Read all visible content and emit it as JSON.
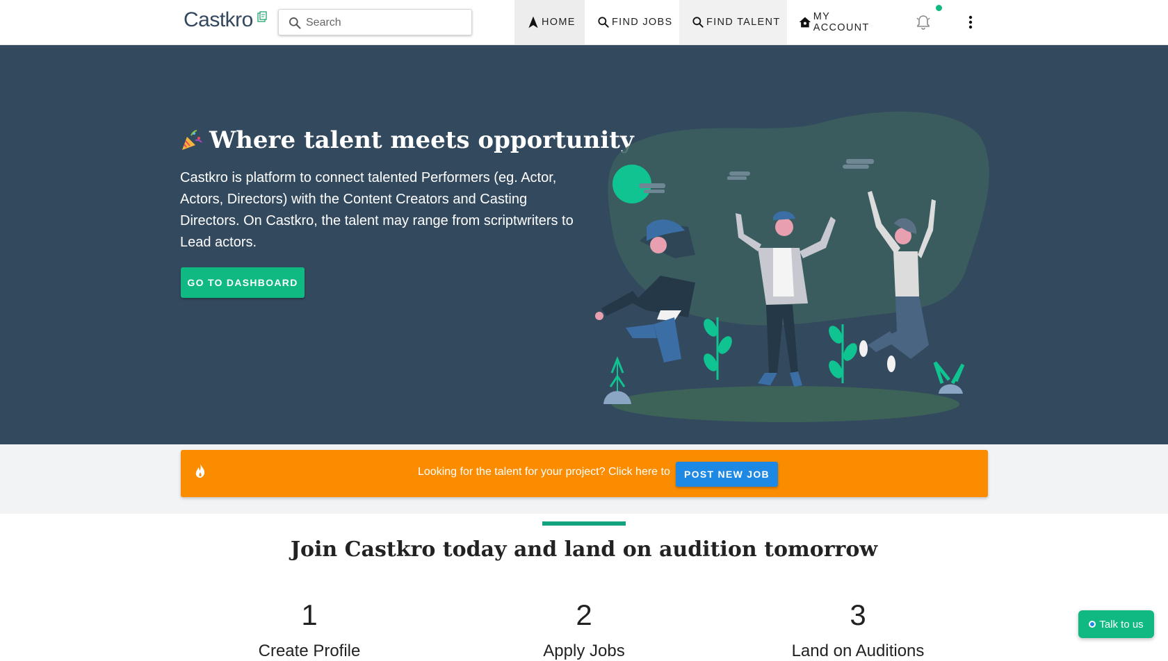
{
  "header": {
    "logo_text": "Castkro",
    "search_placeholder": "Search",
    "nav": {
      "home": "HOME",
      "find_jobs": "FIND JOBS",
      "find_talent": "FIND TALENT",
      "my_account": "MY ACCOUNT"
    },
    "icons": [
      "search-icon",
      "navigation-arrow-icon",
      "bell-icon",
      "more-vert-icon",
      "home-icon"
    ]
  },
  "hero": {
    "title": "Where talent meets opportunity",
    "description": "Castkro is platform to connect talented Performers (eg. Actor, Actors, Directors) with the Content Creators and Casting Directors. On Castkro, the talent may range from scriptwriters to Lead actors.",
    "cta": "GO TO DASHBOARD"
  },
  "banner": {
    "text": "Looking for the talent for your project? Click here to",
    "button": "POST NEW JOB"
  },
  "join": {
    "title": "Join Castkro today and land on audition tomorrow",
    "steps": [
      {
        "number": "1",
        "label": "Create Profile"
      },
      {
        "number": "2",
        "label": "Apply Jobs"
      },
      {
        "number": "3",
        "label": "Land on Auditions"
      }
    ]
  },
  "chat": {
    "label": "Talk to us"
  },
  "colors": {
    "hero_bg": "#33495e",
    "accent_green": "#10b981",
    "banner_orange": "#fb8c00",
    "button_blue": "#1e88e5"
  }
}
